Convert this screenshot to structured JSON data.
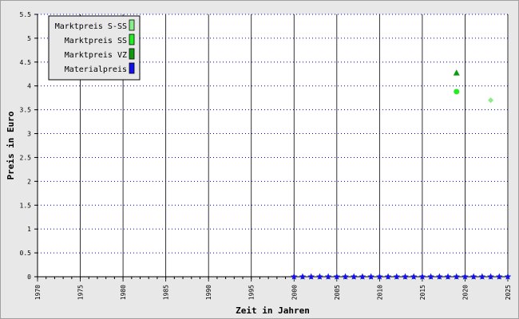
{
  "chart_data": {
    "type": "scatter",
    "xlabel": "Zeit in Jahren",
    "ylabel": "Preis in Euro",
    "xlim": [
      1970,
      2025
    ],
    "ylim": [
      0,
      5.5
    ],
    "x_ticks": [
      1970,
      1975,
      1980,
      1985,
      1990,
      1995,
      2000,
      2005,
      2010,
      2015,
      2020,
      2025
    ],
    "y_ticks": [
      0,
      0.5,
      1,
      1.5,
      2,
      2.5,
      3,
      3.5,
      4,
      4.5,
      5,
      5.5
    ],
    "y_tick_labels": [
      "0",
      "0.5",
      "1",
      "1.5",
      "2",
      "2.5",
      "3",
      "3.5",
      "4",
      "4.5",
      "5",
      "5.5"
    ],
    "grid": "horizontal",
    "legend_position": "top-left",
    "series": [
      {
        "name": "Marktpreis S-SS",
        "color": "#88ee88",
        "marker": "diamond",
        "points": [
          [
            2023,
            3.7
          ]
        ]
      },
      {
        "name": "Marktpreis SS",
        "color": "#22ee22",
        "marker": "circle",
        "points": [
          [
            2019,
            3.88
          ]
        ]
      },
      {
        "name": "Marktpreis VZ",
        "color": "#119911",
        "marker": "triangle",
        "points": [
          [
            2019,
            4.27
          ]
        ]
      },
      {
        "name": "Materialpreis",
        "color": "#1111ee",
        "marker": "star",
        "points": [
          [
            2000,
            0
          ],
          [
            2001,
            0
          ],
          [
            2002,
            0
          ],
          [
            2003,
            0
          ],
          [
            2004,
            0
          ],
          [
            2005,
            0
          ],
          [
            2006,
            0
          ],
          [
            2007,
            0
          ],
          [
            2008,
            0
          ],
          [
            2009,
            0
          ],
          [
            2010,
            0
          ],
          [
            2011,
            0
          ],
          [
            2012,
            0
          ],
          [
            2013,
            0
          ],
          [
            2014,
            0
          ],
          [
            2015,
            0
          ],
          [
            2016,
            0
          ],
          [
            2017,
            0
          ],
          [
            2018,
            0
          ],
          [
            2019,
            0
          ],
          [
            2020,
            0
          ],
          [
            2021,
            0
          ],
          [
            2022,
            0
          ],
          [
            2023,
            0
          ],
          [
            2024,
            0
          ],
          [
            2025,
            0
          ]
        ]
      }
    ]
  }
}
